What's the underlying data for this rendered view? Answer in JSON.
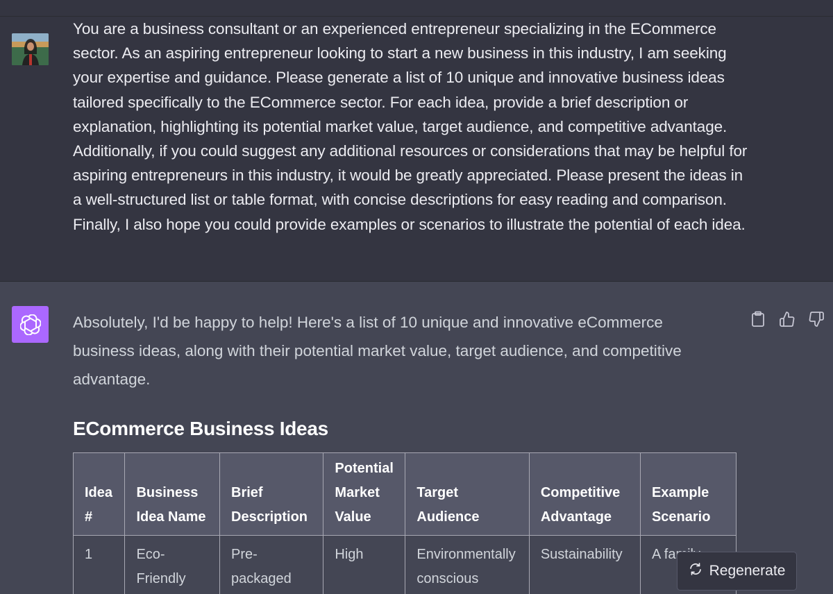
{
  "user": {
    "message": "You are a business consultant or an experienced entrepreneur specializing in the ECommerce sector. As an aspiring entrepreneur looking to start a new business in this industry, I am seeking your expertise and guidance. Please generate a list of 10 unique and innovative business ideas tailored specifically to the ECommerce sector. For each idea, provide a brief description or explanation, highlighting its potential market value, target audience, and competitive advantage. Additionally, if you could suggest any additional resources or considerations that may be helpful for aspiring entrepreneurs in this industry, it would be greatly appreciated. Please present the ideas in a well-structured list or table format, with concise descriptions for easy reading and comparison. Finally, I also hope you could provide examples or scenarios to illustrate the potential of each idea."
  },
  "assistant": {
    "intro": "Absolutely, I'd be happy to help! Here's a list of 10 unique and innovative eCommerce business ideas, along with their potential market value, target audience, and competitive advantage.",
    "heading": "ECommerce Business Ideas",
    "table": {
      "headers": [
        "Idea #",
        "Business Idea Name",
        "Brief Description",
        "Potential Market Value",
        "Target Audience",
        "Competitive Advantage",
        "Example Scenario"
      ],
      "rows": [
        [
          "1",
          "Eco-Friendly Kits",
          "Pre-packaged",
          "High",
          "Environmentally conscious",
          "Sustainability",
          "A family"
        ]
      ]
    },
    "actions": {
      "copy": "clipboard-icon",
      "like": "thumbs-up-icon",
      "dislike": "thumbs-down-icon"
    }
  },
  "regenerate": {
    "label": "Regenerate"
  }
}
